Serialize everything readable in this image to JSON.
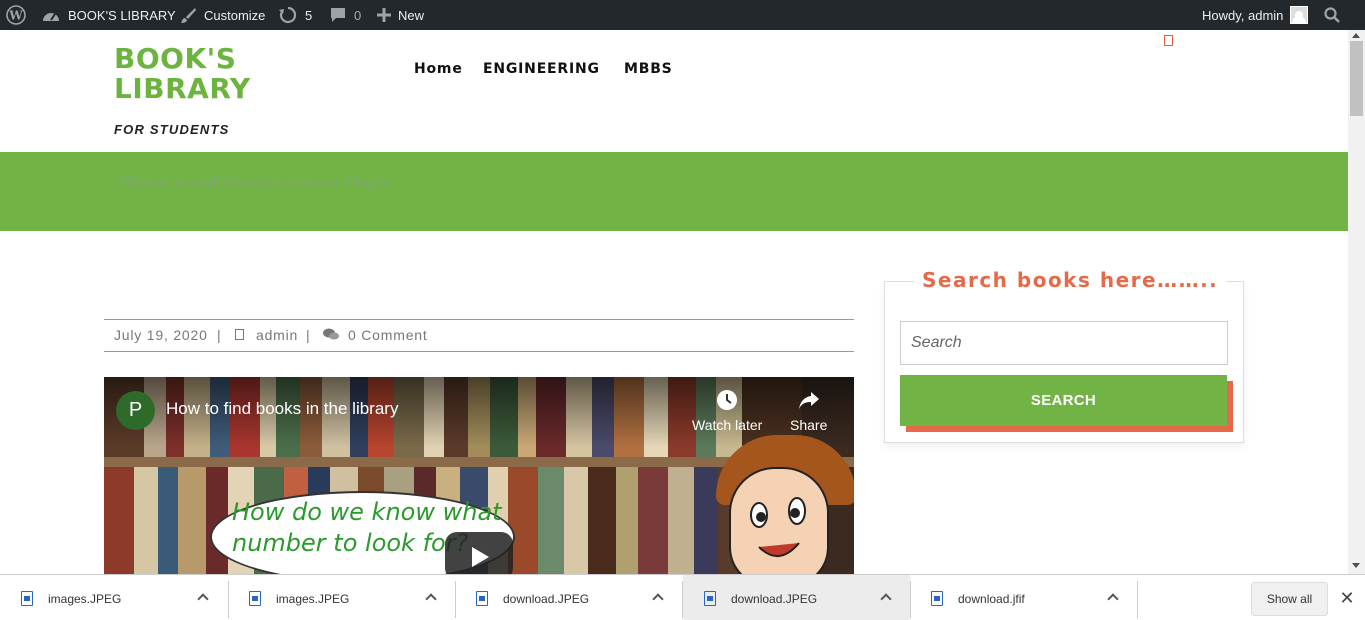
{
  "admin_bar": {
    "site_name": "BOOK'S LIBRARY",
    "customize": "Customize",
    "updates_count": "5",
    "comments_count": "0",
    "new_label": "New",
    "howdy": "Howdy, admin"
  },
  "site": {
    "title_line1": "BOOK'S",
    "title_line2": "LIBRARY",
    "tagline": "FOR STUDENTS",
    "nav": [
      "Home",
      "ENGINEERING",
      "MBBS"
    ]
  },
  "banner": {
    "notice": "Please Install Woocommerce Plugin"
  },
  "post": {
    "date": "July 19, 2020",
    "sep": "|",
    "author": "admin",
    "comments": "0 Comment"
  },
  "video": {
    "channel_initial": "P",
    "title": "How to find books in the library",
    "watch_later": "Watch later",
    "share": "Share",
    "bubble_line1": "How do we know what",
    "bubble_line2": "number to look for?"
  },
  "sidebar": {
    "widget_title": "Search books here……..",
    "search_placeholder": "Search",
    "search_button": "SEARCH"
  },
  "downloads": {
    "items": [
      "images.JPEG",
      "images.JPEG",
      "download.JPEG",
      "download.JPEG",
      "download.jfif"
    ],
    "show_all": "Show all"
  },
  "colors": {
    "brand_green": "#71b345",
    "accent_orange": "#e56a4a",
    "admin_bar": "#23282d"
  }
}
